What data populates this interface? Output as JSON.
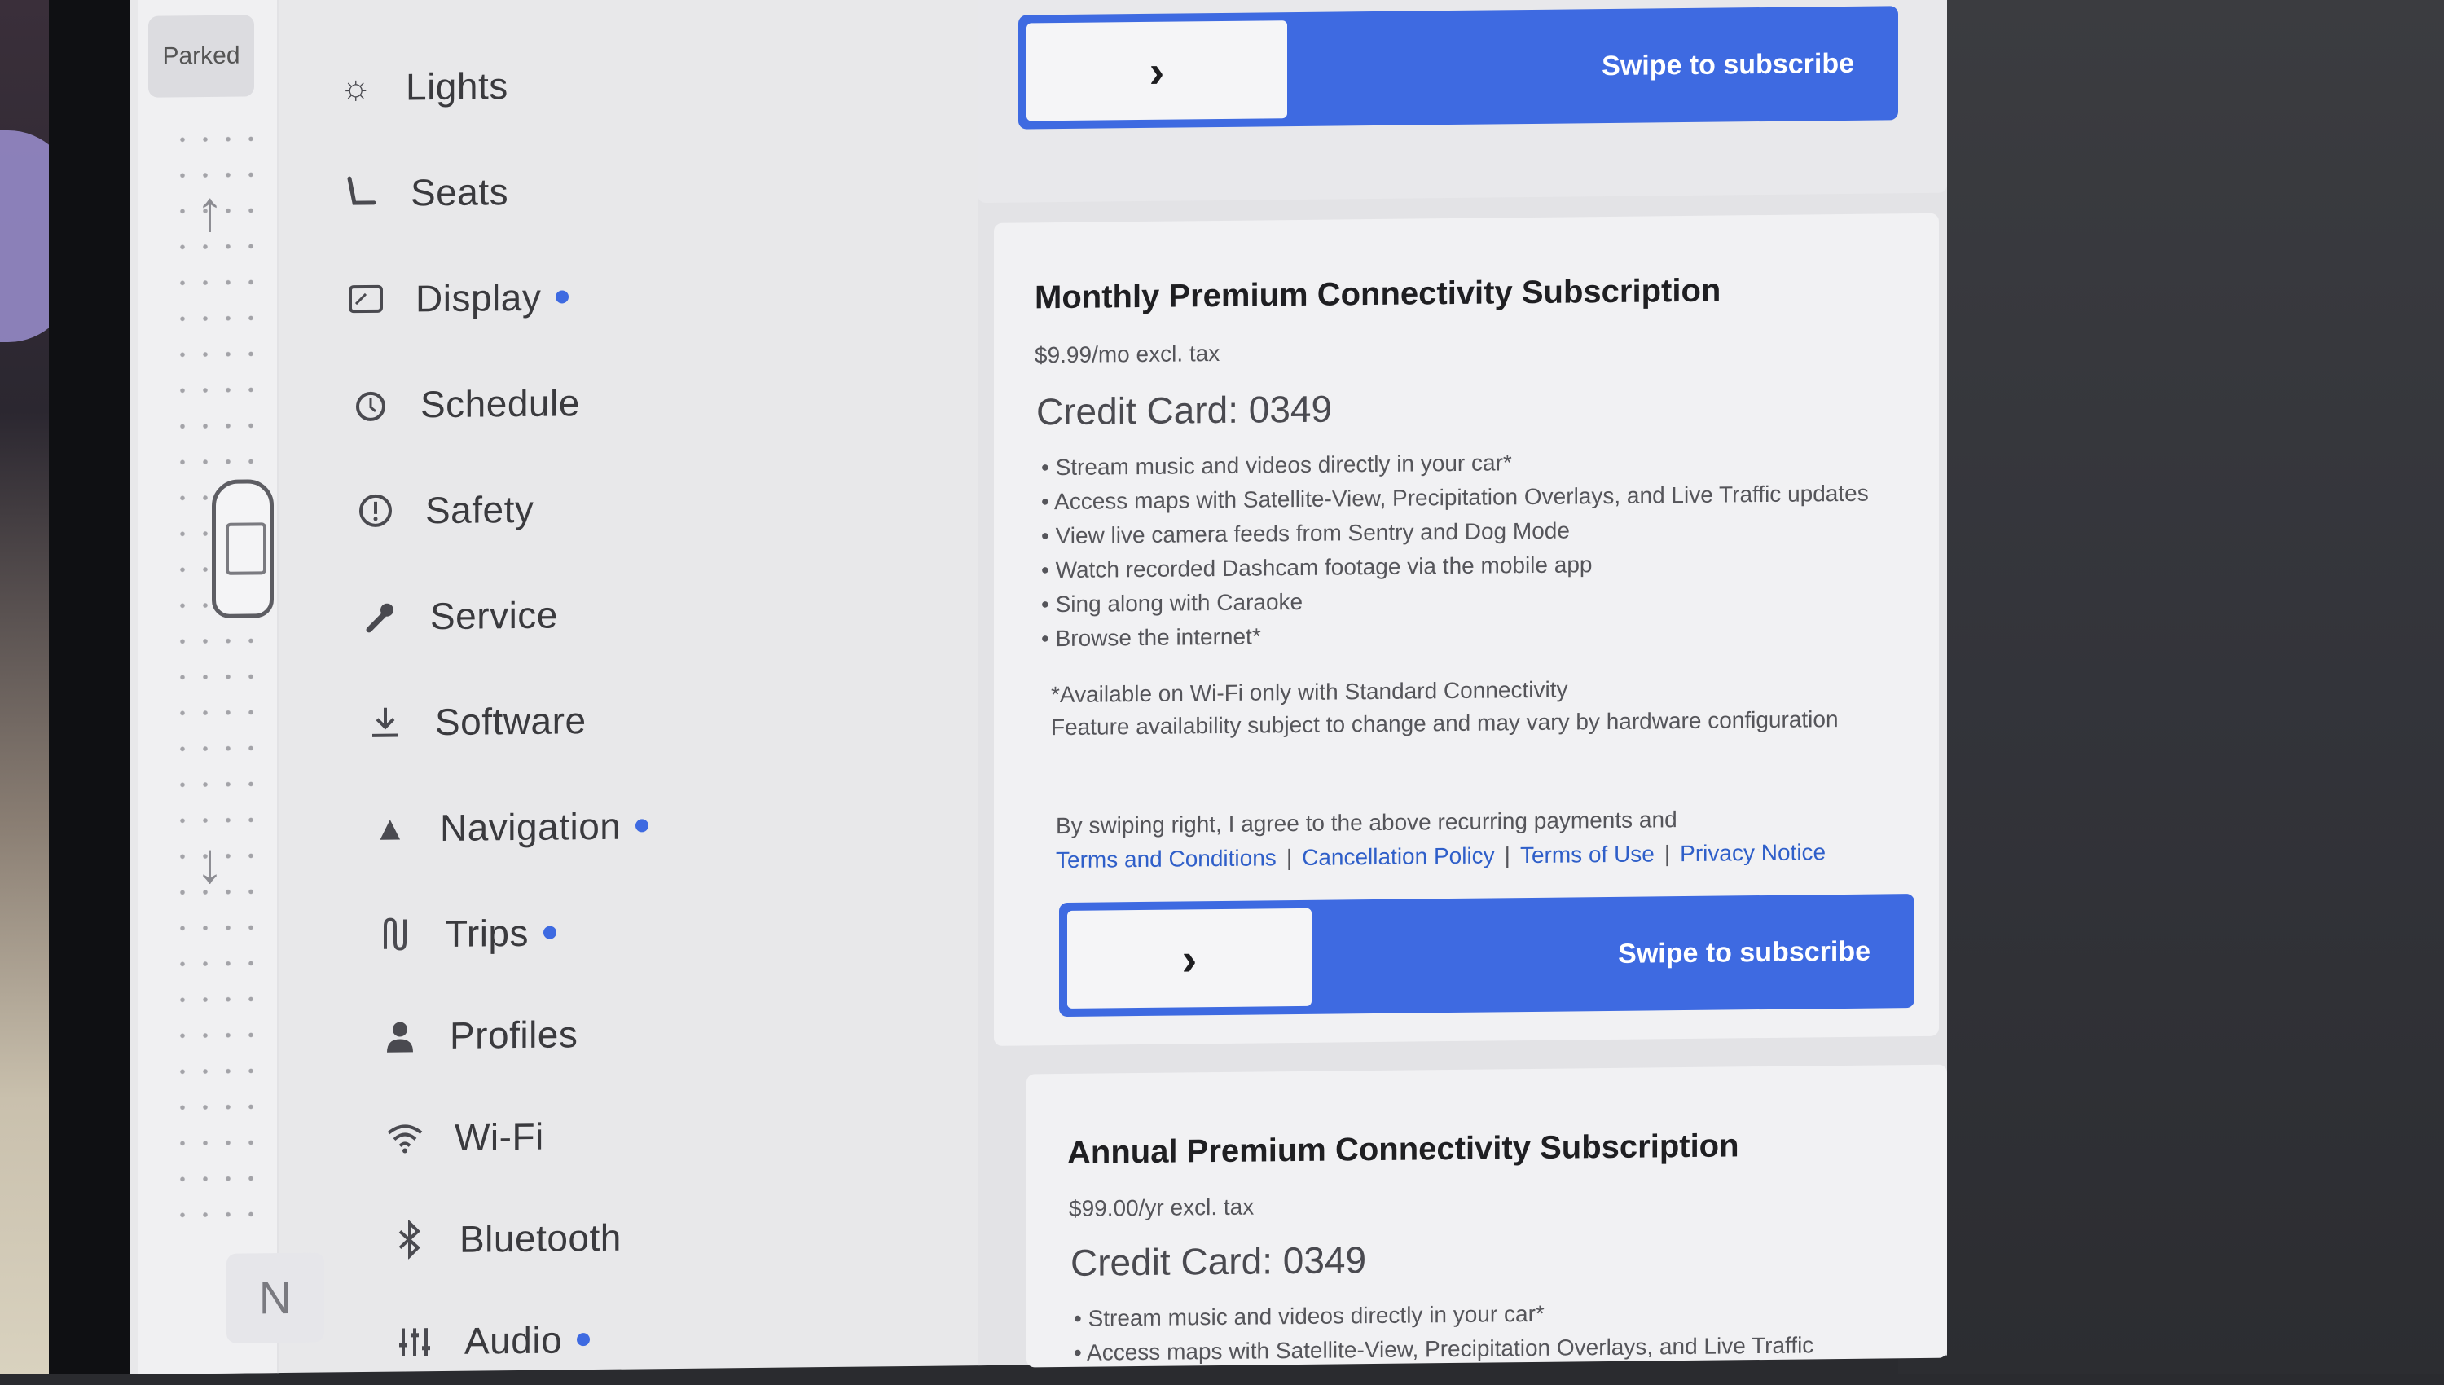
{
  "status": {
    "parked": "Parked",
    "gear": "N"
  },
  "menu": [
    {
      "label": "Lights",
      "icon": "sun-icon",
      "dot": false
    },
    {
      "label": "Seats",
      "icon": "seat-icon",
      "dot": false
    },
    {
      "label": "Display",
      "icon": "display-icon",
      "dot": true
    },
    {
      "label": "Schedule",
      "icon": "schedule-icon",
      "dot": false
    },
    {
      "label": "Safety",
      "icon": "alert-icon",
      "dot": false
    },
    {
      "label": "Service",
      "icon": "wrench-icon",
      "dot": false
    },
    {
      "label": "Software",
      "icon": "download-icon",
      "dot": false
    },
    {
      "label": "Navigation",
      "icon": "navigation-icon",
      "dot": true
    },
    {
      "label": "Trips",
      "icon": "trips-icon",
      "dot": true
    },
    {
      "label": "Profiles",
      "icon": "profile-icon",
      "dot": false
    },
    {
      "label": "Wi-Fi",
      "icon": "wifi-icon",
      "dot": false
    },
    {
      "label": "Bluetooth",
      "icon": "bluetooth-icon",
      "dot": false
    },
    {
      "label": "Audio",
      "icon": "audio-icon",
      "dot": true
    }
  ],
  "swipe_top": {
    "label": "Swipe to subscribe"
  },
  "monthly": {
    "title": "Monthly Premium Connectivity Subscription",
    "price": "$9.99/mo excl. tax",
    "card": "Credit Card: 0349",
    "bullets": [
      "Stream music and videos directly in your car*",
      "Access maps with Satellite-View, Precipitation Overlays, and Live Traffic updates",
      "View live camera feeds from Sentry and Dog Mode",
      "Watch recorded Dashcam footage via the mobile app",
      "Sing along with Caraoke",
      "Browse the internet*"
    ],
    "note1": "*Available on Wi-Fi only with Standard Connectivity",
    "note2": "Feature availability subject to change and may vary by hardware configuration",
    "agree": "By swiping right, I agree to the above recurring payments and",
    "links": [
      "Terms and Conditions",
      "Cancellation Policy",
      "Terms of Use",
      "Privacy Notice"
    ],
    "swipe_label": "Swipe to subscribe"
  },
  "annual": {
    "title": "Annual Premium Connectivity Subscription",
    "price": "$99.00/yr excl. tax",
    "card": "Credit Card: 0349",
    "bullets": [
      "Stream music and videos directly in your car*",
      "Access maps with Satellite-View, Precipitation Overlays, and Live Traffic"
    ]
  },
  "colors": {
    "accent": "#3e6ae1",
    "link": "#2f5fc9"
  }
}
